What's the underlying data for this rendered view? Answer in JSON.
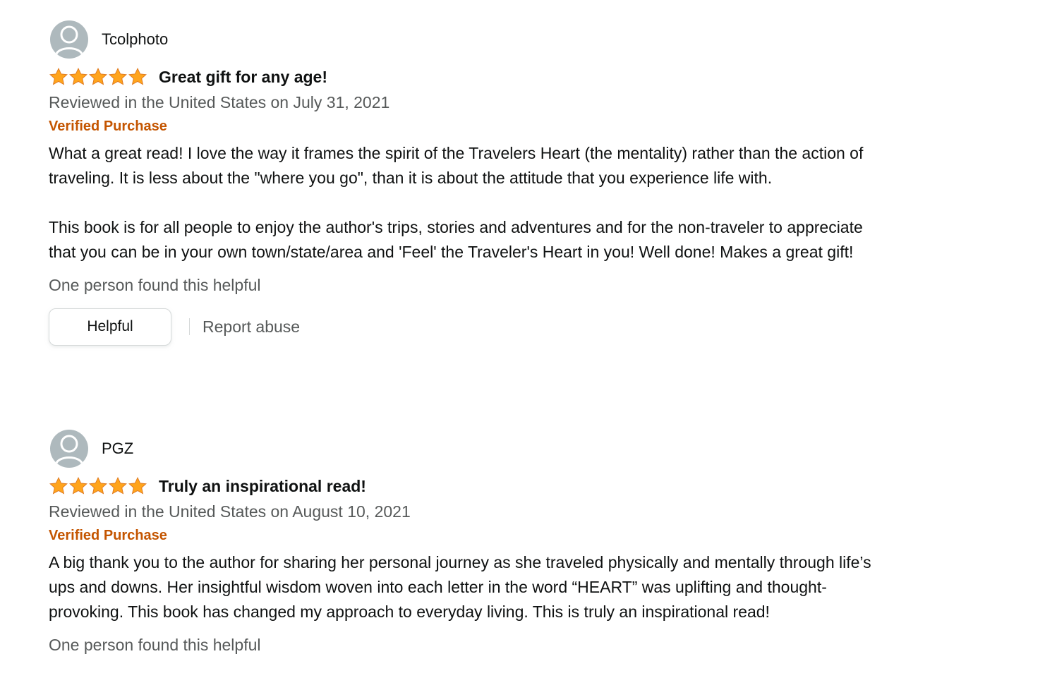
{
  "colors": {
    "star": "#ffa41c",
    "verified": "#c45500",
    "secondary_text": "#565959",
    "avatar_bg": "#aeb9bd"
  },
  "reviews": [
    {
      "profile_name": "Tcolphoto",
      "rating": 5,
      "rating_max": 5,
      "title": "Great gift for any age!",
      "date": "Reviewed in the United States on July 31, 2021",
      "verified": "Verified Purchase",
      "body": [
        "What a great read! I love the way it frames the spirit of the Travelers Heart (the mentality) rather than the action of traveling. It is less about the \"where you go\", than it is about the attitude that you experience life with.",
        "This book is for all people to enjoy the author's trips, stories and adventures and for the non-traveler to appreciate that you can be in your own town/state/area and 'Feel' the Traveler's Heart in you! Well done! Makes a great gift!"
      ],
      "helpful_count": "One person found this helpful",
      "helpful_button": "Helpful",
      "report_link": "Report abuse"
    },
    {
      "profile_name": "PGZ",
      "rating": 5,
      "rating_max": 5,
      "title": "Truly an inspirational read!",
      "date": "Reviewed in the United States on August 10, 2021",
      "verified": "Verified Purchase",
      "body": [
        "A big thank you to the author for sharing her personal journey as she traveled physically and mentally through life’s ups and downs. Her insightful wisdom woven into each letter in the word “HEART” was uplifting and thought-provoking. This book has changed my approach to everyday living. This is truly an inspirational read!"
      ],
      "helpful_count": "One person found this helpful"
    }
  ]
}
